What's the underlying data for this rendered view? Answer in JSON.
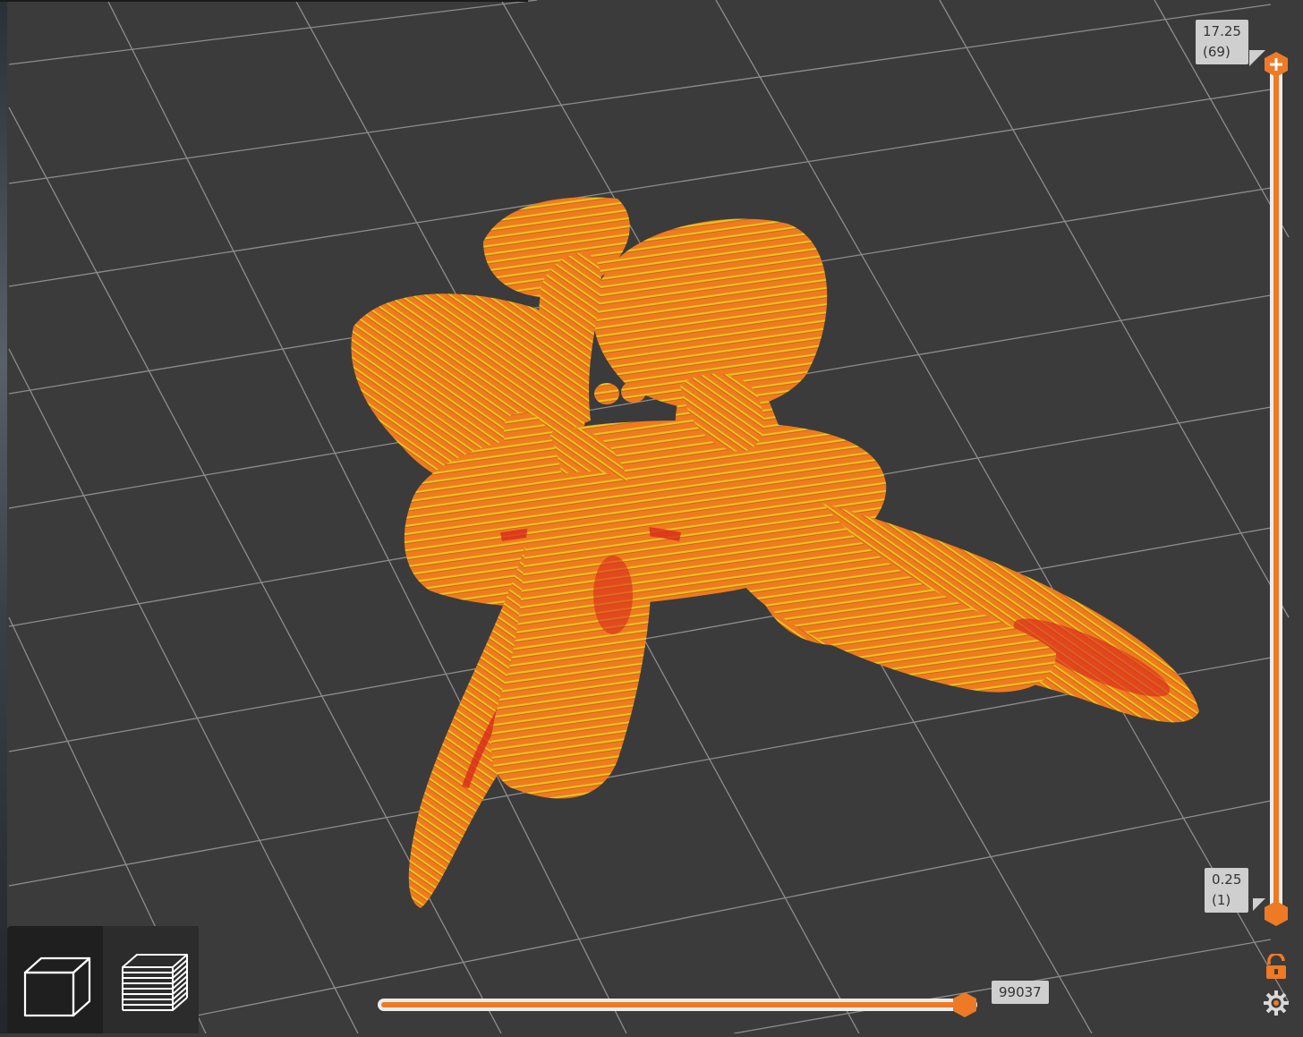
{
  "viewport": {
    "model": "flower",
    "background": "#3b3b3b",
    "grid_color": "#8a8a8a",
    "colors": {
      "filament_orange": "#ef7b1e",
      "layer_yellow": "#e8d21a",
      "layer_red": "#d82a1e"
    }
  },
  "layer_slider": {
    "top_value": "17.25",
    "top_layer": "(69)",
    "bottom_value": "0.25",
    "bottom_layer": "(1)",
    "accent": "#ee7a25",
    "top_icon": "plus-icon",
    "bottom_icon": "hexagon-handle-icon"
  },
  "move_slider": {
    "value": "99037",
    "accent": "#ee7a25"
  },
  "view_modes": [
    {
      "name": "3d-view",
      "icon": "cube-icon",
      "active": false
    },
    {
      "name": "preview-layers",
      "icon": "layers-icon",
      "active": true
    }
  ],
  "corner_icons": {
    "lock": "unlock-icon",
    "settings": "gear-icon"
  }
}
